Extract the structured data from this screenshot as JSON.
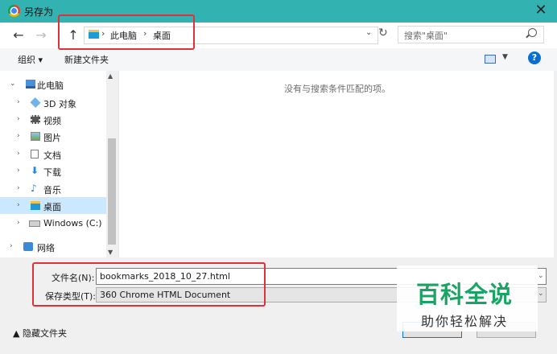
{
  "window": {
    "title": "另存为",
    "close": "✕"
  },
  "address": {
    "back": "←",
    "forward": "→",
    "up": "↑",
    "crumbs": [
      "此电脑",
      "桌面"
    ],
    "search_placeholder": "搜索\"桌面\""
  },
  "toolbar": {
    "organize": "组织 ▾",
    "new_folder": "新建文件夹"
  },
  "tree": [
    {
      "label": "此电脑",
      "icon": "computer-icon"
    },
    {
      "label": "3D 对象",
      "icon": "3d-objects-icon"
    },
    {
      "label": "视频",
      "icon": "video-icon"
    },
    {
      "label": "图片",
      "icon": "pictures-icon"
    },
    {
      "label": "文档",
      "icon": "documents-icon"
    },
    {
      "label": "下载",
      "icon": "downloads-icon"
    },
    {
      "label": "音乐",
      "icon": "music-icon"
    },
    {
      "label": "桌面",
      "icon": "desktop-icon",
      "selected": true
    },
    {
      "label": "Windows (C:)",
      "icon": "drive-icon"
    },
    {
      "label": "网络",
      "icon": "network-icon"
    }
  ],
  "content": {
    "empty_message": "没有与搜索条件匹配的项。"
  },
  "form": {
    "filename_label": "文件名(N):",
    "filename_value": "bookmarks_2018_10_27.html",
    "filetype_label": "保存类型(T):",
    "filetype_value": "360 Chrome HTML Document"
  },
  "footer": {
    "hide_folders": "▲ 隐藏文件夹"
  },
  "watermark": {
    "title": "百科全说",
    "subtitle": "助你轻松解决"
  },
  "colors": {
    "titlebar": "#33b2b2",
    "annotation": "#e0303a",
    "watermark": "#19a463",
    "selection": "#cce8ff"
  }
}
